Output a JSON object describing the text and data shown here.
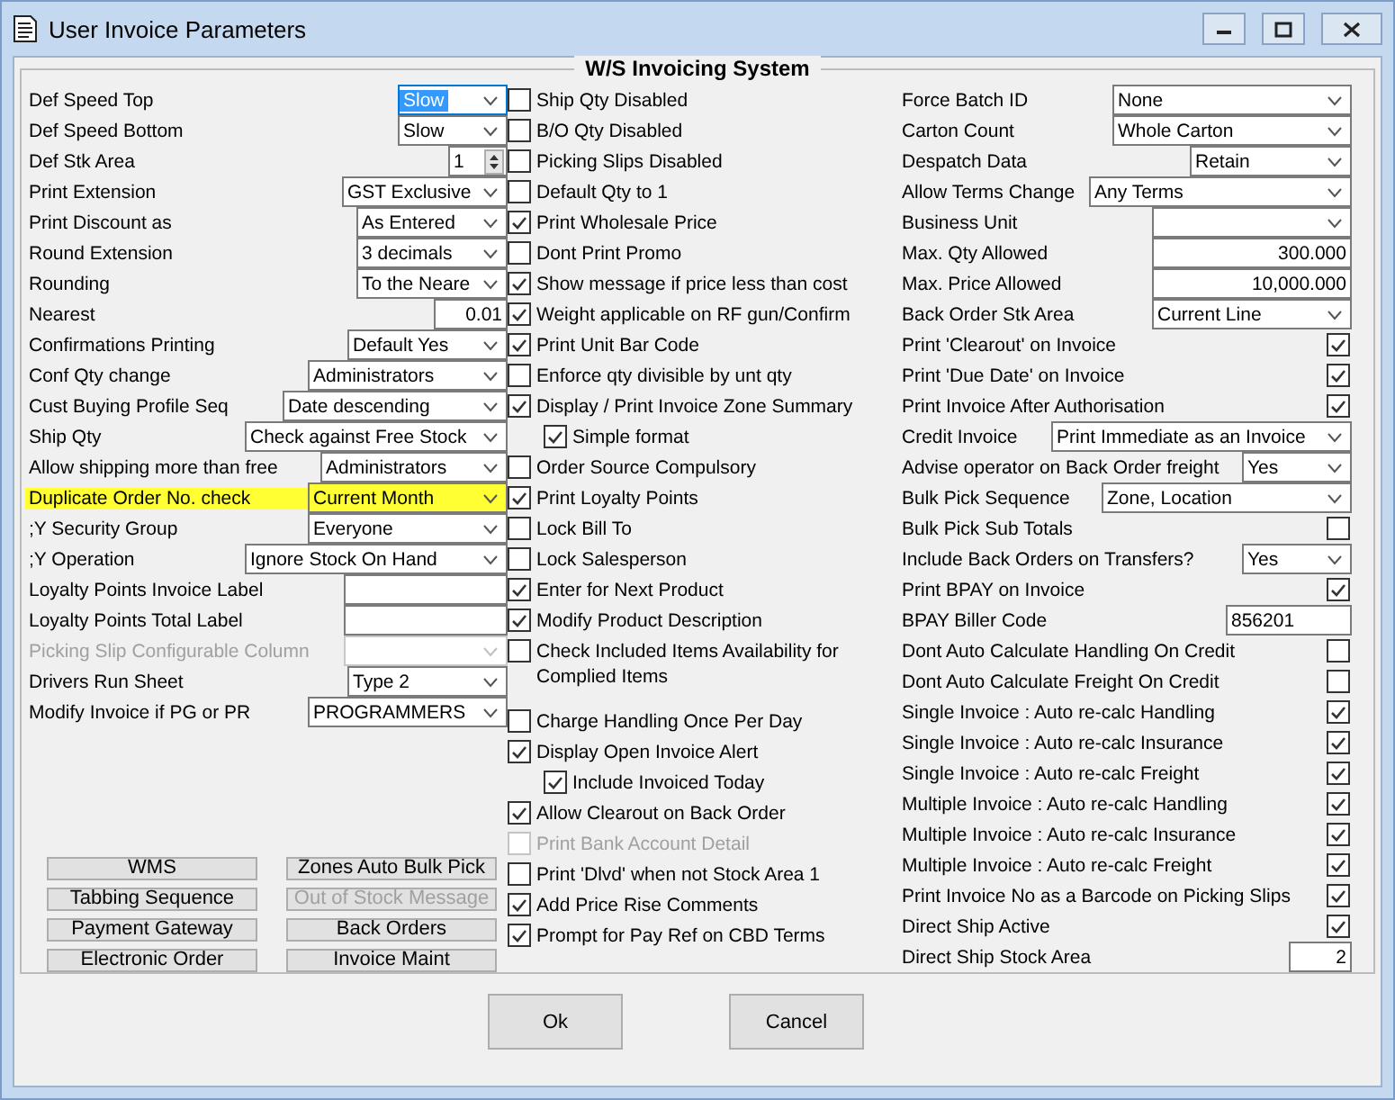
{
  "window": {
    "title": "User Invoice Parameters"
  },
  "group": {
    "title": "W/S Invoicing System"
  },
  "left_fields": [
    {
      "label": "Def Speed Top",
      "kind": "select",
      "value": "Slow",
      "focused": true,
      "highlighted": false,
      "disabled": false
    },
    {
      "label": "Def Speed Bottom",
      "kind": "select",
      "value": "Slow",
      "focused": false,
      "highlighted": false,
      "disabled": false
    },
    {
      "label": "Def Stk Area",
      "kind": "spin",
      "value": "1",
      "focused": false,
      "highlighted": false,
      "disabled": false
    },
    {
      "label": "Print Extension",
      "kind": "select",
      "value": "GST Exclusive",
      "focused": false,
      "highlighted": false,
      "disabled": false
    },
    {
      "label": "Print Discount as",
      "kind": "select",
      "value": "As Entered",
      "focused": false,
      "highlighted": false,
      "disabled": false
    },
    {
      "label": "Round Extension",
      "kind": "select",
      "value": "3 decimals",
      "focused": false,
      "highlighted": false,
      "disabled": false
    },
    {
      "label": "Rounding",
      "kind": "select",
      "value": "To the Neare",
      "focused": false,
      "highlighted": false,
      "disabled": false
    },
    {
      "label": "Nearest",
      "kind": "number",
      "value": "0.01",
      "focused": false,
      "highlighted": false,
      "disabled": false
    },
    {
      "label": "Confirmations Printing",
      "kind": "select",
      "value": "Default Yes",
      "focused": false,
      "highlighted": false,
      "disabled": false
    },
    {
      "label": "Conf Qty change",
      "kind": "select",
      "value": "Administrators",
      "focused": false,
      "highlighted": false,
      "disabled": false
    },
    {
      "label": "Cust Buying Profile Seq",
      "kind": "select",
      "value": "Date descending",
      "focused": false,
      "highlighted": false,
      "disabled": false
    },
    {
      "label": "Ship Qty",
      "kind": "select",
      "value": "Check against Free Stock",
      "focused": false,
      "highlighted": false,
      "disabled": false
    },
    {
      "label": "Allow shipping more than free",
      "kind": "select",
      "value": "Administrators",
      "focused": false,
      "highlighted": false,
      "disabled": false
    },
    {
      "label": "Duplicate Order No. check",
      "kind": "select",
      "value": "Current Month",
      "focused": false,
      "highlighted": true,
      "disabled": false
    },
    {
      "label": ";Y Security Group",
      "kind": "select",
      "value": "Everyone",
      "focused": false,
      "highlighted": false,
      "disabled": false
    },
    {
      "label": ";Y Operation",
      "kind": "select",
      "value": "Ignore Stock On Hand",
      "focused": false,
      "highlighted": false,
      "disabled": false
    },
    {
      "label": "Loyalty Points Invoice Label",
      "kind": "text",
      "focused": false,
      "highlighted": false,
      "disabled": false
    },
    {
      "label": "Loyalty Points Total Label",
      "kind": "text",
      "focused": false,
      "highlighted": false,
      "disabled": false
    },
    {
      "label": "Picking Slip Configurable Column",
      "kind": "select",
      "focused": false,
      "highlighted": false,
      "disabled": true
    },
    {
      "label": "Drivers Run Sheet",
      "kind": "select",
      "value": "Type 2",
      "focused": false,
      "highlighted": false,
      "disabled": false
    },
    {
      "label": "Modify Invoice if PG or PR",
      "kind": "select",
      "value": "PROGRAMMERS",
      "focused": false,
      "highlighted": false,
      "disabled": false
    }
  ],
  "action_buttons": [
    {
      "label": "WMS",
      "disabled": false
    },
    {
      "label": "Zones Auto Bulk Pick",
      "disabled": false
    },
    {
      "label": "Tabbing Sequence",
      "disabled": false
    },
    {
      "label": "Out of Stock Message",
      "disabled": true
    },
    {
      "label": "Payment Gateway",
      "disabled": false
    },
    {
      "label": "Back Orders",
      "disabled": false
    },
    {
      "label": "Electronic Order",
      "disabled": false
    },
    {
      "label": "Invoice Maint",
      "disabled": false
    }
  ],
  "options": [
    {
      "label": "Ship Qty Disabled",
      "checked": false,
      "disabled": false
    },
    {
      "label": "B/O Qty Disabled",
      "checked": false,
      "disabled": false
    },
    {
      "label": "Picking Slips Disabled",
      "checked": false,
      "disabled": false
    },
    {
      "label": "Default Qty to 1",
      "checked": false,
      "disabled": false
    },
    {
      "label": "Print Wholesale Price",
      "checked": true,
      "disabled": false
    },
    {
      "label": "Dont Print Promo",
      "checked": false,
      "disabled": false
    },
    {
      "label": "Show message if price less than cost",
      "checked": true,
      "disabled": false
    },
    {
      "label": "Weight applicable on RF gun/Confirm",
      "checked": true,
      "disabled": false
    },
    {
      "label": "Print Unit Bar Code",
      "checked": true,
      "disabled": false
    },
    {
      "label": "Enforce qty divisible by unt qty",
      "checked": false,
      "disabled": false
    },
    {
      "label": "Display / Print Invoice Zone Summary",
      "checked": true,
      "disabled": false,
      "children": [
        {
          "label": "Simple format",
          "checked": true,
          "disabled": false
        }
      ]
    },
    {
      "label": "Order Source Compulsory",
      "checked": false,
      "disabled": false
    },
    {
      "label": "Print Loyalty Points",
      "checked": true,
      "disabled": false
    },
    {
      "label": "Lock Bill To",
      "checked": false,
      "disabled": false
    },
    {
      "label": "Lock Salesperson",
      "checked": false,
      "disabled": false
    },
    {
      "label": "Enter for Next Product",
      "checked": true,
      "disabled": false
    },
    {
      "label": "Modify Product Description",
      "checked": true,
      "disabled": false
    },
    {
      "label": "Check Included Items Availability for Complied Items",
      "checked": false,
      "disabled": false
    },
    {
      "label": "Charge Handling Once Per Day",
      "checked": false,
      "disabled": false
    },
    {
      "label": "Display Open Invoice Alert",
      "checked": true,
      "disabled": false,
      "children": [
        {
          "label": "Include Invoiced Today",
          "checked": true,
          "disabled": false
        }
      ]
    },
    {
      "label": "Allow Clearout on Back Order",
      "checked": true,
      "disabled": false
    },
    {
      "label": "Print Bank Account Detail",
      "checked": false,
      "disabled": true
    },
    {
      "label": "Print 'Dlvd' when not Stock Area 1",
      "checked": false,
      "disabled": false
    },
    {
      "label": "Add Price Rise Comments",
      "checked": true,
      "disabled": false
    },
    {
      "label": "Prompt for Pay Ref on CBD Terms",
      "checked": true,
      "disabled": false
    }
  ],
  "right_fields": [
    {
      "label": "Force Batch ID",
      "kind": "select",
      "value": "None"
    },
    {
      "label": "Carton Count",
      "kind": "select",
      "value": "Whole Carton"
    },
    {
      "label": "Despatch Data",
      "kind": "select",
      "value": "Retain"
    },
    {
      "label": "Allow Terms Change",
      "kind": "select",
      "value": "Any Terms"
    },
    {
      "label": "Business Unit",
      "kind": "select"
    },
    {
      "label": "Max. Qty Allowed",
      "kind": "number",
      "value": "300.000"
    },
    {
      "label": "Max. Price Allowed",
      "kind": "number",
      "value": "10,000.000"
    },
    {
      "label": "Back Order Stk Area",
      "kind": "select",
      "value": "Current Line"
    },
    {
      "label": "Print 'Clearout' on Invoice",
      "kind": "check",
      "checked": true
    },
    {
      "label": "Print 'Due Date' on Invoice",
      "kind": "check",
      "checked": true
    },
    {
      "label": "Print Invoice After Authorisation",
      "kind": "check",
      "checked": true
    },
    {
      "label": "Credit Invoice",
      "kind": "select",
      "value": "Print Immediate as an Invoice"
    },
    {
      "label": "Advise operator on Back Order freight",
      "kind": "select",
      "value": "Yes"
    },
    {
      "label": "Bulk Pick Sequence",
      "kind": "select",
      "value": "Zone, Location"
    },
    {
      "label": "Bulk Pick Sub Totals",
      "kind": "check",
      "checked": false
    },
    {
      "label": "Include Back Orders on Transfers?",
      "kind": "select",
      "value": "Yes"
    },
    {
      "label": "Print BPAY on Invoice",
      "kind": "check",
      "checked": true
    },
    {
      "label": "BPAY Biller Code",
      "kind": "text",
      "value": "856201"
    },
    {
      "label": "Dont Auto Calculate Handling On Credit",
      "kind": "check",
      "checked": false
    },
    {
      "label": "Dont Auto Calculate Freight On Credit",
      "kind": "check",
      "checked": false
    },
    {
      "label": "Single Invoice : Auto re-calc Handling",
      "kind": "check",
      "checked": true
    },
    {
      "label": "Single Invoice : Auto re-calc Insurance",
      "kind": "check",
      "checked": true
    },
    {
      "label": "Single Invoice : Auto re-calc Freight",
      "kind": "check",
      "checked": true
    },
    {
      "label": "Multiple Invoice : Auto re-calc Handling",
      "kind": "check",
      "checked": true
    },
    {
      "label": "Multiple Invoice : Auto re-calc Insurance",
      "kind": "check",
      "checked": true
    },
    {
      "label": "Multiple Invoice : Auto re-calc Freight",
      "kind": "check",
      "checked": true
    },
    {
      "label": "Print Invoice No as a Barcode on Picking Slips",
      "kind": "check",
      "checked": true
    },
    {
      "label": "Direct Ship Active",
      "kind": "check",
      "checked": true
    },
    {
      "label": "Direct Ship Stock Area",
      "kind": "number",
      "value": "2"
    }
  ],
  "dialog_buttons": [
    "Ok",
    "Cancel"
  ]
}
